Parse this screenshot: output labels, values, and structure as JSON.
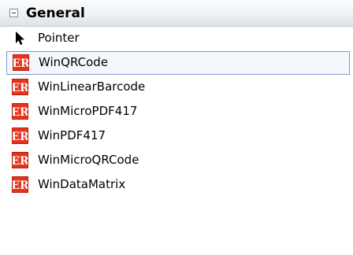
{
  "group": {
    "title": "General",
    "expanded": true
  },
  "items": [
    {
      "label": "Pointer",
      "icon": "pointer-arrow-icon"
    },
    {
      "label": "WinQRCode",
      "icon": "er-logo-icon",
      "selected": true
    },
    {
      "label": "WinLinearBarcode",
      "icon": "er-logo-icon"
    },
    {
      "label": "WinMicroPDF417",
      "icon": "er-logo-icon"
    },
    {
      "label": "WinPDF417",
      "icon": "er-logo-icon"
    },
    {
      "label": "WinMicroQRCode",
      "icon": "er-logo-icon"
    },
    {
      "label": "WinDataMatrix",
      "icon": "er-logo-icon"
    }
  ],
  "colors": {
    "icon_red": "#e8331c",
    "selection_border": "#7a9ec9"
  }
}
